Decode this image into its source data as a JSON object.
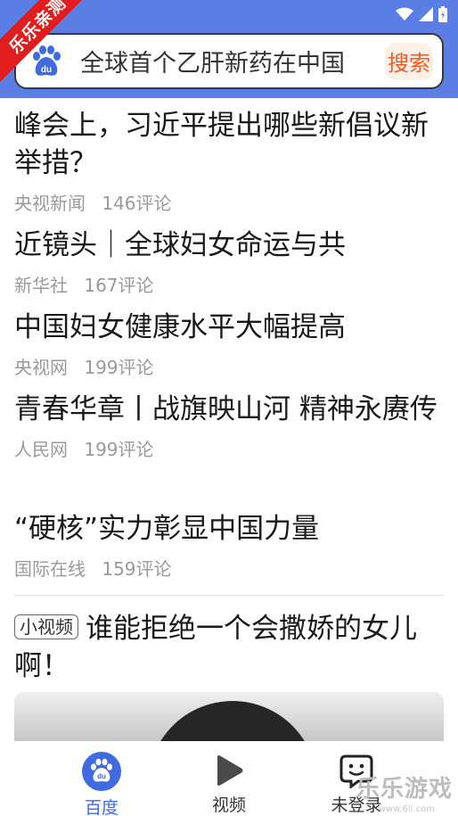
{
  "ribbon": {
    "label": "乐乐亲测"
  },
  "search": {
    "value": "全球首个乙肝新药在中国",
    "button_label": "搜索"
  },
  "feed": {
    "items": [
      {
        "title": "峰会上，习近平提出哪些新倡议新举措？",
        "source": "央视新闻",
        "comments": "146评论"
      },
      {
        "title": "近镜头｜全球妇女命运与共",
        "source": "新华社",
        "comments": "167评论"
      },
      {
        "title": "中国妇女健康水平大幅提高",
        "source": "央视网",
        "comments": "199评论"
      },
      {
        "title": "青春华章丨战旗映山河 精神永赓传",
        "source": "人民网",
        "comments": "199评论"
      },
      {
        "title": "“硬核”实力彰显中国力量",
        "source": "国际在线",
        "comments": "159评论"
      }
    ],
    "video": {
      "badge": "小视频",
      "title": "谁能拒绝一个会撒娇的女儿啊！"
    }
  },
  "bottom_nav": {
    "items": [
      {
        "label": "百度",
        "icon": "baidu-paw-icon",
        "active": true
      },
      {
        "label": "视频",
        "icon": "play-icon",
        "active": false
      },
      {
        "label": "未登录",
        "icon": "user-face-icon",
        "active": false
      }
    ]
  },
  "watermark": {
    "text": "乐乐游戏",
    "url": "www.6ll.com"
  },
  "colors": {
    "header": "#5b7ee5",
    "accent": "#3f6ae0",
    "search_button": "#f05a1e",
    "ribbon": "#e21d1d"
  }
}
